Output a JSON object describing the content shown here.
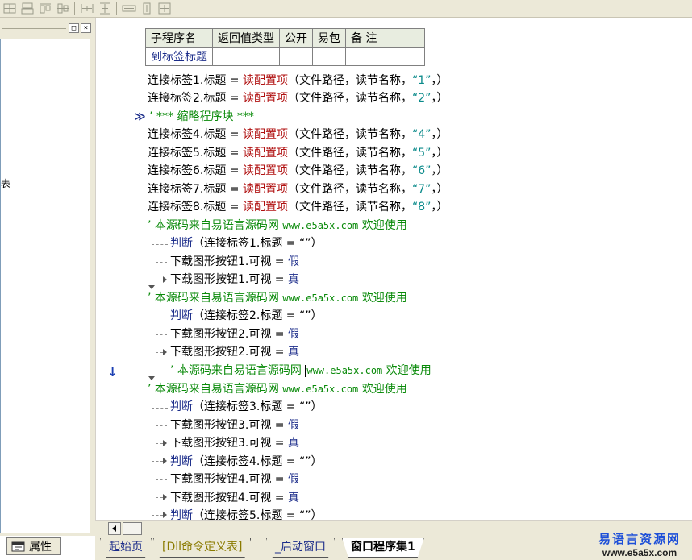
{
  "toolbar": {
    "buttons": [
      "align-left-icon",
      "align-center-icon",
      "align-top-icon",
      "align-middle-icon",
      "equal-width-icon",
      "equal-height-icon",
      "same-width-icon",
      "same-height-icon",
      "same-size-icon"
    ]
  },
  "left_panel": {
    "controls": [
      "□",
      "×"
    ],
    "stub_text": "表"
  },
  "property_tab": {
    "label": "属性"
  },
  "sub_table": {
    "headers": [
      "子程序名",
      "返回值类型",
      "公开",
      "易包",
      "备 注"
    ],
    "row": [
      "到标签标题",
      "",
      "",
      "",
      ""
    ]
  },
  "code": {
    "l1": {
      "a": "连接标签1.标题 = ",
      "fn": "读配置项",
      "b": "（文件路径，读节名称，",
      "str": "“1”",
      "c": "，）"
    },
    "l2": {
      "a": "连接标签2.标题 = ",
      "fn": "读配置项",
      "b": "（文件路径，读节名称，",
      "str": "“2”",
      "c": "，）"
    },
    "fold": {
      "marker": "≫",
      "text": "’ *** 缩略程序块 ***"
    },
    "l4": {
      "a": "连接标签4.标题 = ",
      "fn": "读配置项",
      "b": "（文件路径，读节名称，",
      "str": "“4”",
      "c": "，）"
    },
    "l5": {
      "a": "连接标签5.标题 = ",
      "fn": "读配置项",
      "b": "（文件路径，读节名称，",
      "str": "“5”",
      "c": "，）"
    },
    "l6": {
      "a": "连接标签6.标题 = ",
      "fn": "读配置项",
      "b": "（文件路径，读节名称，",
      "str": "“6”",
      "c": "，）"
    },
    "l7": {
      "a": "连接标签7.标题 = ",
      "fn": "读配置项",
      "b": "（文件路径，读节名称，",
      "str": "“7”",
      "c": "，）"
    },
    "l8": {
      "a": "连接标签8.标题 = ",
      "fn": "读配置项",
      "b": "（文件路径，读节名称，",
      "str": "“8”",
      "c": "，）"
    },
    "comment": {
      "prefix": "’ 本源码来自易语言源码网 ",
      "url": "www.e5a5x.com",
      "suffix": "  欢迎使用"
    },
    "if1": {
      "kw": "判断",
      "rest": "（连接标签1.标题 = “”）"
    },
    "set1a": {
      "a": "下载图形按钮1.可视 = ",
      "v": "假"
    },
    "set1b": {
      "a": "下载图形按钮1.可视 = ",
      "v": "真"
    },
    "if2": {
      "kw": "判断",
      "rest": "（连接标签2.标题 = “”）"
    },
    "set2a": {
      "a": "下载图形按钮2.可视 = ",
      "v": "假"
    },
    "set2b": {
      "a": "下载图形按钮2.可视 = ",
      "v": "真"
    },
    "if3": {
      "kw": "判断",
      "rest": "（连接标签3.标题 = “”）"
    },
    "set3a": {
      "a": "下载图形按钮3.可视 = ",
      "v": "假"
    },
    "set3b": {
      "a": "下载图形按钮3.可视 = ",
      "v": "真"
    },
    "if4": {
      "kw": "判断",
      "rest": "（连接标签4.标题 = “”）"
    },
    "set4a": {
      "a": "下载图形按钮4.可视 = ",
      "v": "假"
    },
    "set4b": {
      "a": "下载图形按钮4.可视 = ",
      "v": "真"
    },
    "if5": {
      "kw": "判断",
      "rest": "（连接标签5.标题 = “”）"
    }
  },
  "gutter": {
    "arrow": "↓"
  },
  "tabs": [
    "起始页",
    "[Dll命令定义表]",
    "_启动窗口",
    "窗口程序集1"
  ],
  "watermark": {
    "title": "易语言资源网",
    "url": "www.e5a5x.com"
  },
  "colors": {
    "keyword": "#1c2d8a",
    "function": "#b01010",
    "string": "#0a8a8a",
    "comment": "#0a8a0a"
  }
}
